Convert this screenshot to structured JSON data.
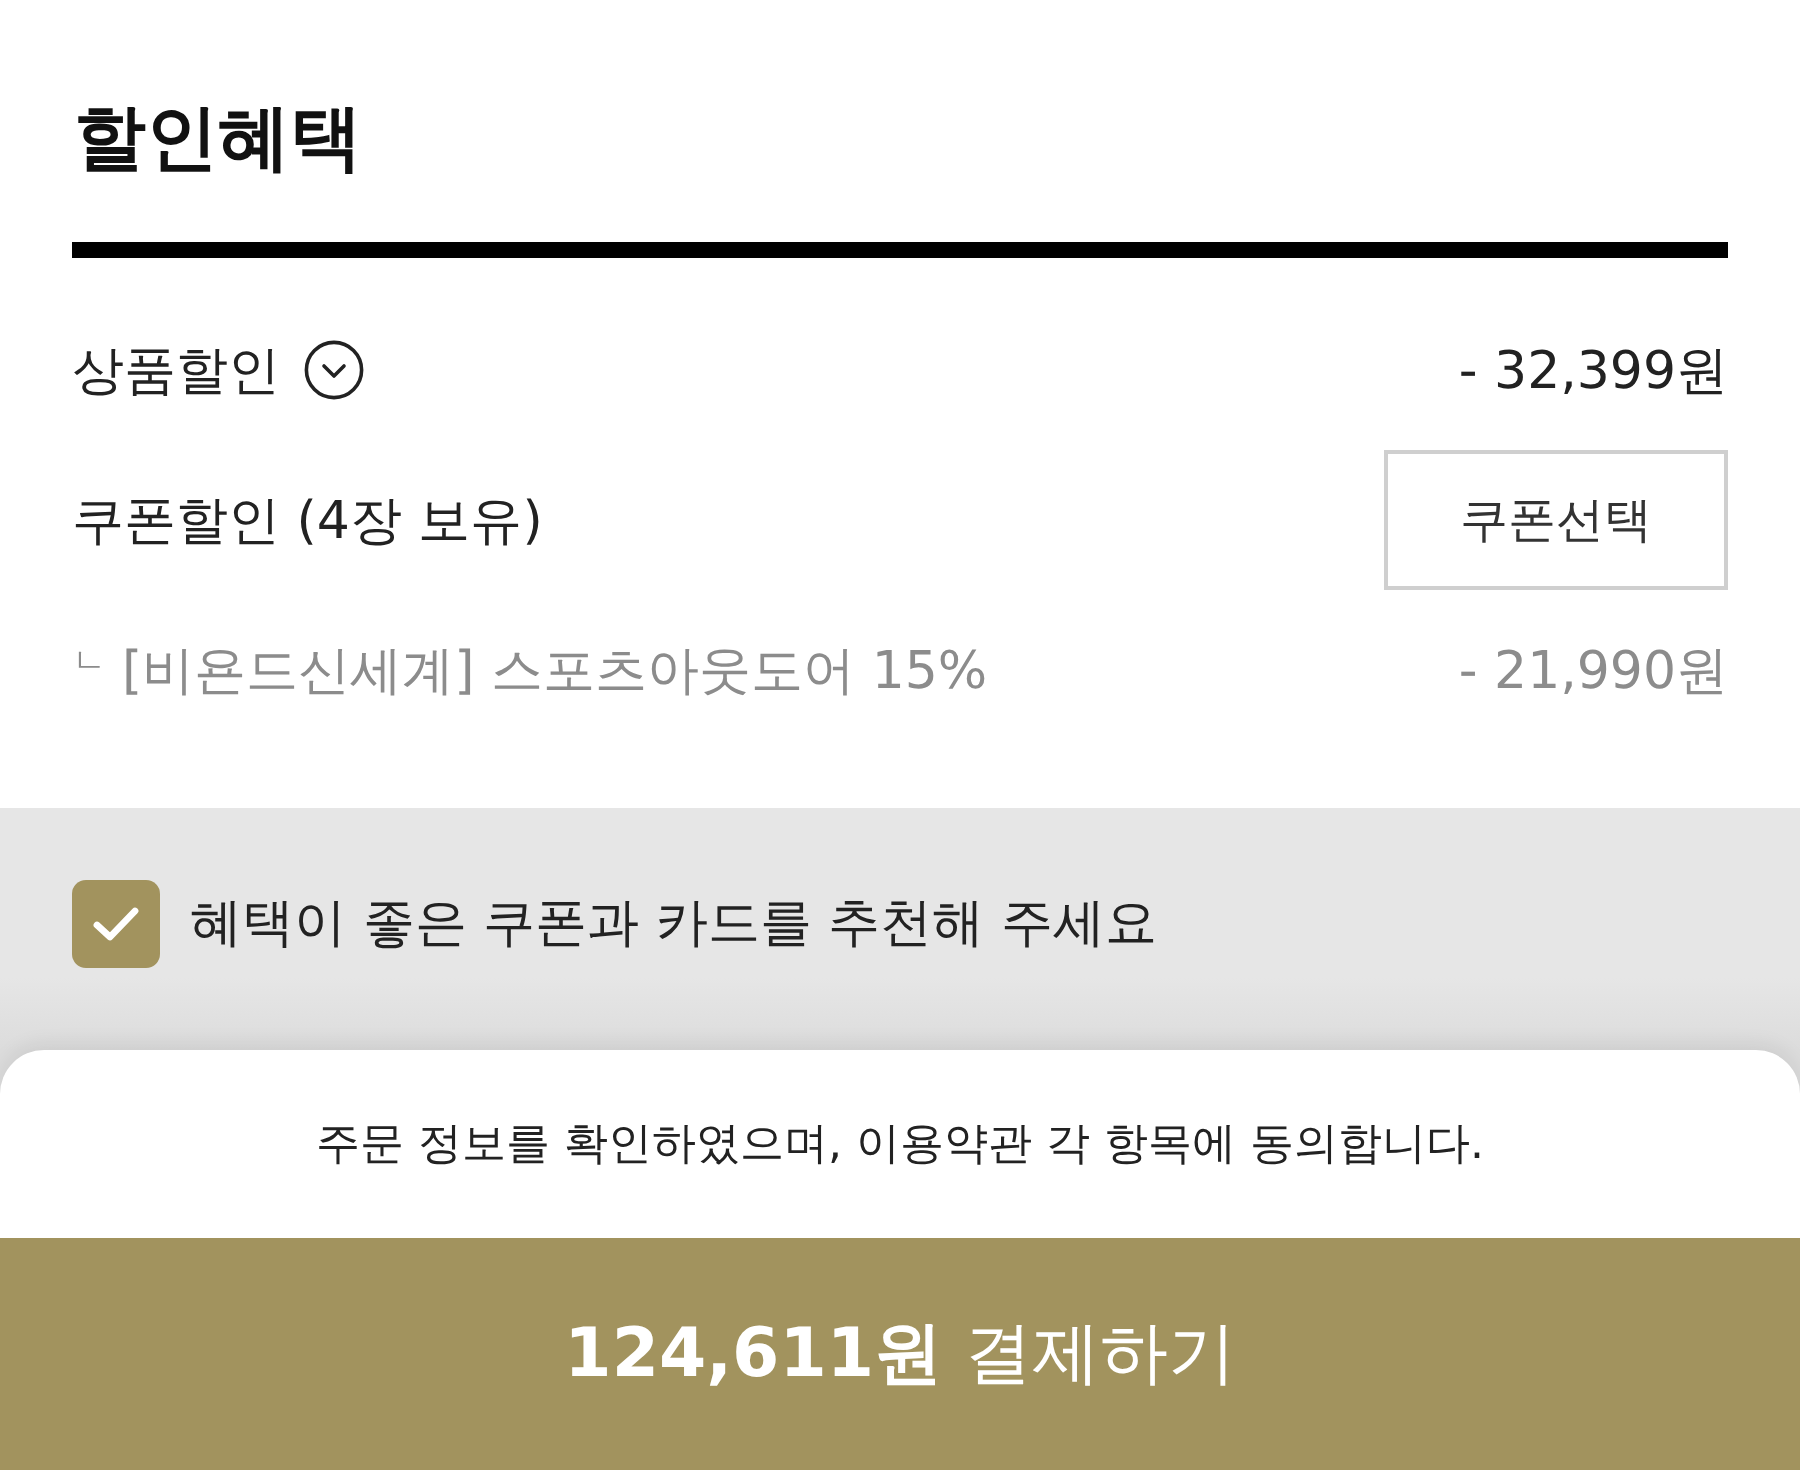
{
  "section": {
    "title": "할인혜택"
  },
  "rows": [
    {
      "kind": "expandable",
      "label": "상품할인",
      "expanded": false,
      "amount": "- 32,399원"
    },
    {
      "kind": "action",
      "label": "쿠폰할인 (4장 보유)",
      "button": "쿠폰선택"
    },
    {
      "kind": "sub",
      "marker": "ㄴ",
      "label": "[비욘드신세계] 스포츠아웃도어 15%",
      "amount": "- 21,990원"
    }
  ],
  "recommend": {
    "label": "혜택이 좋은 쿠폰과 카드를 추천해 주세요",
    "checked": true
  },
  "agreement": "주문 정보를 확인하였으며, 이용약관 각 항목에 동의합니다.",
  "pay_button": "**124,611원** 결제하기"
}
